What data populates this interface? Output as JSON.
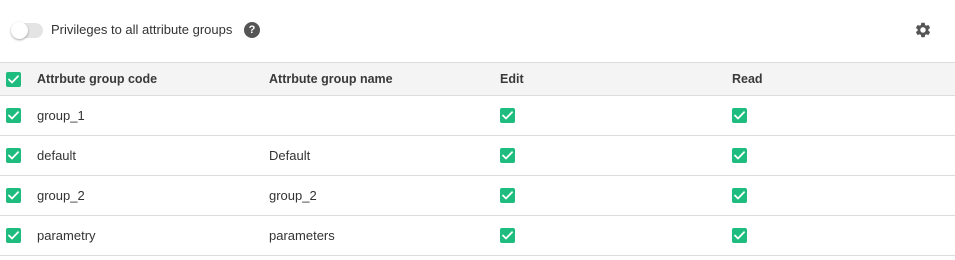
{
  "toolbar": {
    "toggle_label": "Privileges to all attribute groups",
    "toggle_on": false,
    "help_glyph": "?",
    "help_icon": "question-circle-icon",
    "settings_icon": "gear-icon"
  },
  "colors": {
    "checkbox_green": "#1ebc7e",
    "header_bg": "#f4f4f4",
    "border": "#dcdcdc"
  },
  "table": {
    "columns": [
      "Attrbute group code",
      "Attrbute group name",
      "Edit",
      "Read"
    ],
    "select_all_checked": true,
    "rows": [
      {
        "selected": true,
        "code": "group_1",
        "name": "",
        "edit": true,
        "read": true
      },
      {
        "selected": true,
        "code": "default",
        "name": "Default",
        "edit": true,
        "read": true
      },
      {
        "selected": true,
        "code": "group_2",
        "name": "group_2",
        "edit": true,
        "read": true
      },
      {
        "selected": true,
        "code": "parametry",
        "name": "parameters",
        "edit": true,
        "read": true
      }
    ]
  }
}
